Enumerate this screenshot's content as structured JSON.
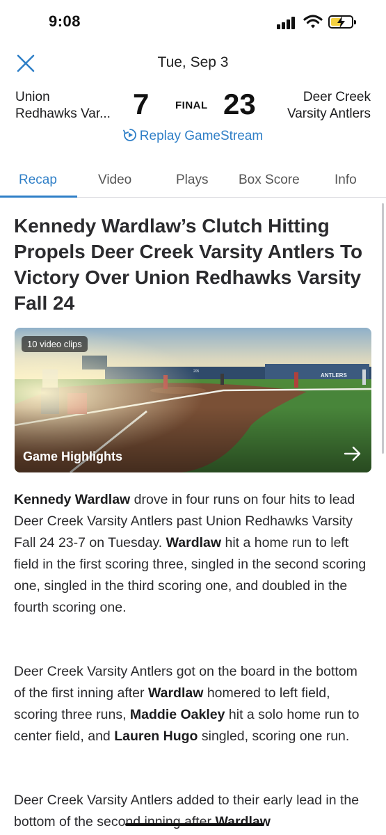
{
  "status_bar": {
    "time": "9:08"
  },
  "header": {
    "date": "Tue, Sep 3"
  },
  "game": {
    "home_team": {
      "line1": "Union",
      "line2": "Redhawks Var..."
    },
    "away_team": {
      "line1": "Deer Creek",
      "line2": "Varsity Antlers"
    },
    "home_score": "7",
    "away_score": "23",
    "status": "FINAL",
    "replay_label": "Replay GameStream"
  },
  "tabs": [
    {
      "label": "Recap",
      "active": true
    },
    {
      "label": "Video",
      "active": false
    },
    {
      "label": "Plays",
      "active": false
    },
    {
      "label": "Box Score",
      "active": false
    },
    {
      "label": "Info",
      "active": false
    }
  ],
  "article": {
    "headline": "Kennedy Wardlaw’s Clutch Hitting Propels Deer Creek Varsity Antlers To Victory Over Union Redhawks Varsity Fall 24",
    "video": {
      "badge": "10 video clips",
      "label": "Game Highlights",
      "scene_sign": "ANTLERS",
      "scene_number": "205"
    },
    "paragraphs": [
      [
        {
          "bold": true,
          "text": "Kennedy Wardlaw"
        },
        {
          "bold": false,
          "text": " drove in four runs on four hits to lead Deer Creek Varsity Antlers past Union Redhawks Varsity Fall 24 23-7 on Tuesday. "
        },
        {
          "bold": true,
          "text": "Wardlaw"
        },
        {
          "bold": false,
          "text": " hit a home run to left field in the first scoring three, singled in the second scoring one, singled in the third scoring one, and doubled in the fourth scoring one."
        }
      ],
      [
        {
          "bold": false,
          "text": "Deer Creek Varsity Antlers got on the board in the bottom of the first inning after "
        },
        {
          "bold": true,
          "text": "Wardlaw"
        },
        {
          "bold": false,
          "text": " homered to left field, scoring three runs, "
        },
        {
          "bold": true,
          "text": "Maddie Oakley"
        },
        {
          "bold": false,
          "text": " hit a solo home run to center field, and "
        },
        {
          "bold": true,
          "text": "Lauren Hugo"
        },
        {
          "bold": false,
          "text": " singled, scoring one run."
        }
      ],
      [
        {
          "bold": false,
          "text": "Deer Creek Varsity Antlers added to their early lead in the bottom of the second inning after "
        },
        {
          "bold": true,
          "text": "Wardlaw"
        }
      ]
    ]
  },
  "colors": {
    "accent": "#2f7fc7",
    "text": "#2b2b2e",
    "battery": "#f4d03f"
  }
}
